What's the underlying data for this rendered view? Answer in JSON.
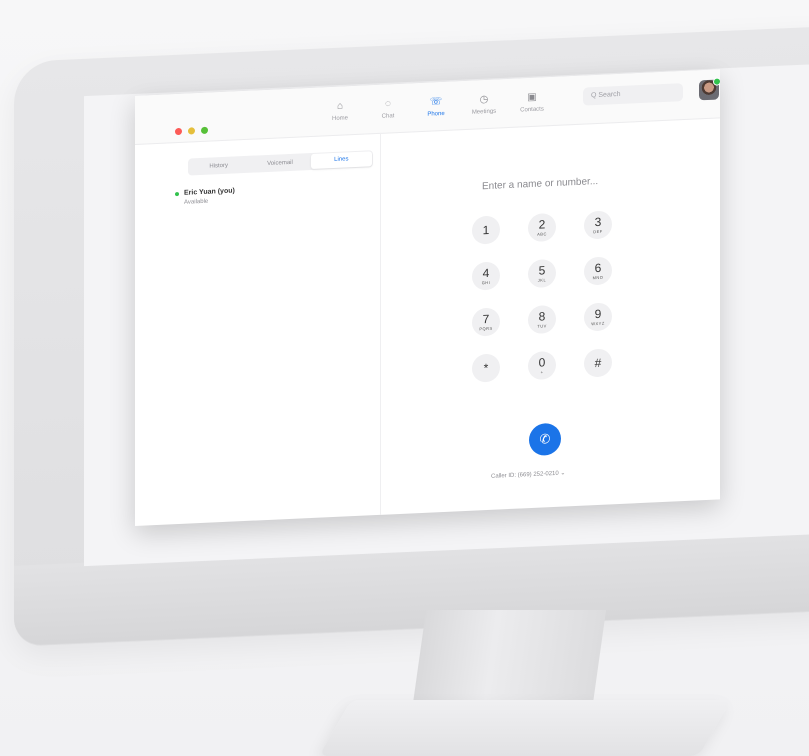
{
  "nav": [
    {
      "icon": "home-icon",
      "glyph": "⌂",
      "label": "Home",
      "active": false
    },
    {
      "icon": "chat-icon",
      "glyph": "◌",
      "label": "Chat",
      "active": false
    },
    {
      "icon": "phone-icon",
      "glyph": "☏",
      "label": "Phone",
      "active": true
    },
    {
      "icon": "clock-icon",
      "glyph": "◷",
      "label": "Meetings",
      "active": false
    },
    {
      "icon": "contacts-icon",
      "glyph": "▣",
      "label": "Contacts",
      "active": false
    }
  ],
  "search": {
    "placeholder": "Q Search"
  },
  "tabs": [
    "History",
    "Voicemail",
    "Lines"
  ],
  "active_tab": "Lines",
  "user": {
    "name": "Eric Yuan (you)",
    "status": "Available"
  },
  "dial": {
    "prompt": "Enter a name or number...",
    "keys": [
      {
        "d": "1",
        "l": ""
      },
      {
        "d": "2",
        "l": "ABC"
      },
      {
        "d": "3",
        "l": "DEF"
      },
      {
        "d": "4",
        "l": "GHI"
      },
      {
        "d": "5",
        "l": "JKL"
      },
      {
        "d": "6",
        "l": "MNO"
      },
      {
        "d": "7",
        "l": "PQRS"
      },
      {
        "d": "8",
        "l": "TUV"
      },
      {
        "d": "9",
        "l": "WXYZ"
      },
      {
        "d": "*",
        "l": ""
      },
      {
        "d": "0",
        "l": "+"
      },
      {
        "d": "#",
        "l": ""
      }
    ],
    "caller_id": "Caller ID: (669) 252-0210 ⌄"
  },
  "colors": {
    "accent": "#1b74e8",
    "traffic_red": "#fc5b57",
    "traffic_yellow": "#e5bf3c",
    "traffic_green": "#57c038"
  }
}
